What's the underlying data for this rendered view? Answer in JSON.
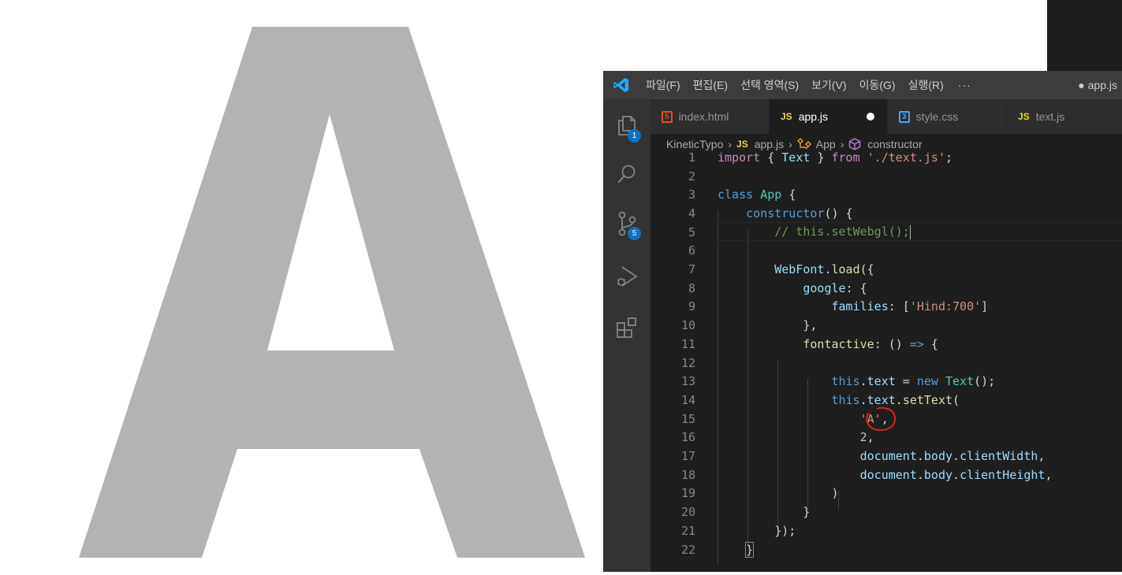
{
  "preview": {
    "letter": "A",
    "letter_color": "#b3b3b3"
  },
  "titlebar": {
    "menus": [
      "파일(F)",
      "편집(E)",
      "선택 영역(S)",
      "보기(V)",
      "이동(G)",
      "실행(R)"
    ],
    "more": "···",
    "window_title": "● app.js"
  },
  "activity": {
    "explorer_badge": "1",
    "scm_badge": "5"
  },
  "tabs": [
    {
      "label": "index.html",
      "icon": "5"
    },
    {
      "label": "app.js",
      "icon": "JS"
    },
    {
      "label": "style.css",
      "icon": "3"
    },
    {
      "label": "text.js",
      "icon": "JS"
    }
  ],
  "breadcrumb": {
    "folder": "KineticTypo",
    "file_icon": "JS",
    "file": "app.js",
    "class": "App",
    "method": "constructor"
  },
  "editor": {
    "line_numbers": [
      "1",
      "2",
      "3",
      "4",
      "5",
      "6",
      "7",
      "8",
      "9",
      "10",
      "11",
      "12",
      "13",
      "14",
      "15",
      "16",
      "17",
      "18",
      "19",
      "20",
      "21",
      "22"
    ],
    "l1": {
      "kw": "import",
      "ob": "{",
      "name": "Text",
      "cb": "}",
      "from": "from",
      "path": "'./text.js'",
      "semi": ";"
    },
    "l3": {
      "kw": "class",
      "name": "App",
      "ob": "{"
    },
    "l4": {
      "fn": "constructor",
      "rest": "() {"
    },
    "l5": {
      "comment": "// this.setWebgl();"
    },
    "l7": {
      "obj": "WebFont",
      "dot": ".",
      "fn": "load",
      "rest": "({"
    },
    "l8": {
      "prop": "google",
      "rest": ": {"
    },
    "l9": {
      "prop": "families",
      "rest": ": [",
      "str": "'Hind:700'",
      "end": "]"
    },
    "l10": {
      "text": "},"
    },
    "l11": {
      "fn": "fontactive",
      "mid": ": () ",
      "arrow": "=>",
      "end": " {"
    },
    "l13": {
      "this": "this",
      "dot": ".",
      "prop": "text",
      "eq": " = ",
      "new": "new",
      "cls": "Text",
      "end": "();"
    },
    "l14": {
      "this": "this",
      "dot": ".",
      "prop": "text",
      "dot2": ".",
      "fn": "setText",
      "end": "("
    },
    "l15": {
      "str": "'A'",
      "end": ","
    },
    "l16": {
      "num": "2",
      "end": ","
    },
    "l17": {
      "obj": "document",
      "dot": ".",
      "p1": "body",
      "dot2": ".",
      "p2": "clientWidth",
      "end": ","
    },
    "l18": {
      "obj": "document",
      "dot": ".",
      "p1": "body",
      "dot2": ".",
      "p2": "clientHeight",
      "end": ","
    },
    "l19": {
      "text": ")"
    },
    "l20": {
      "text": "}"
    },
    "l21": {
      "text": "});"
    },
    "l22": {
      "text": "}"
    }
  }
}
